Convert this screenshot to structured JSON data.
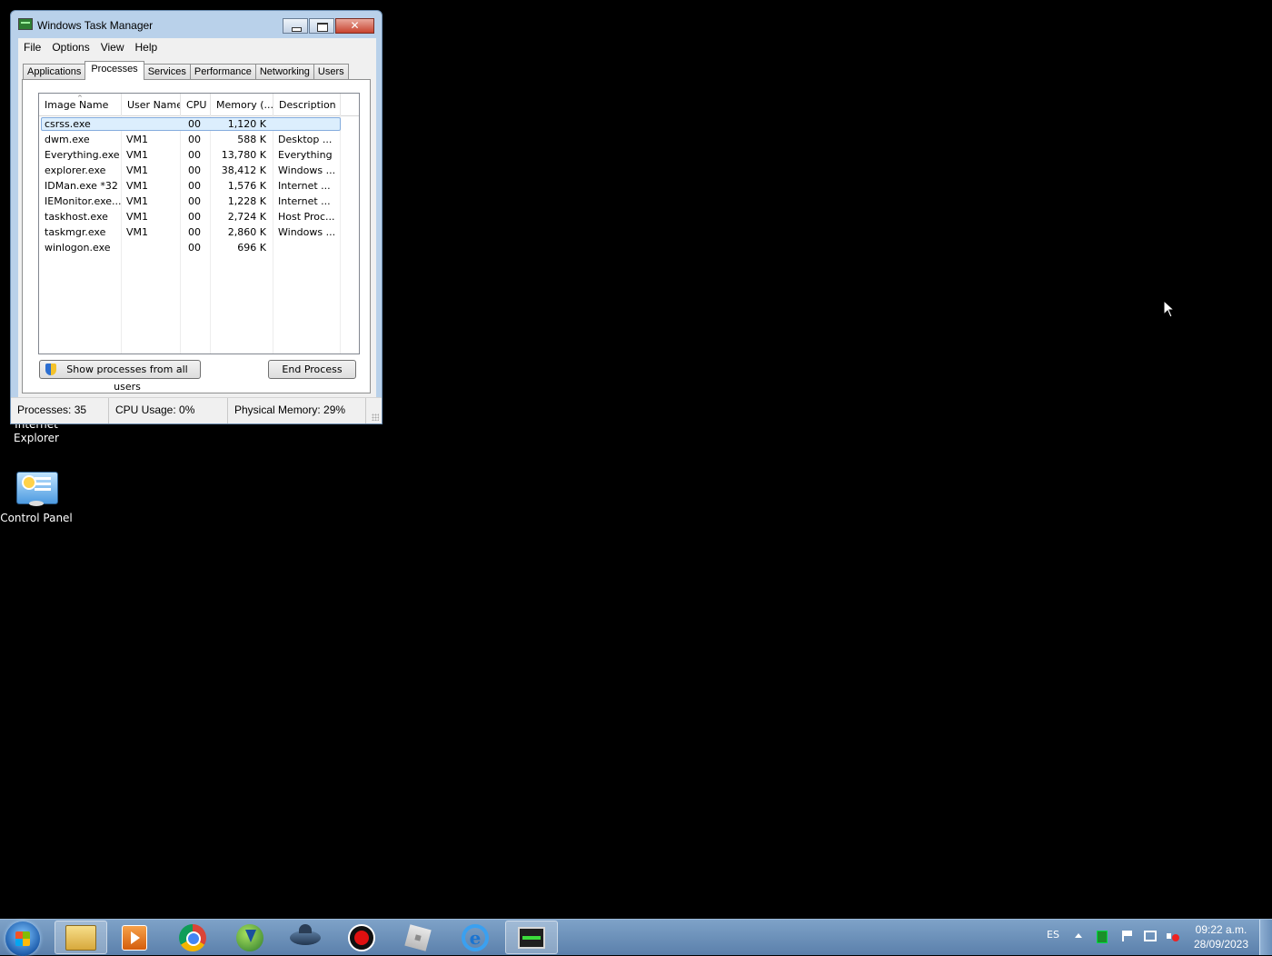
{
  "desktop": {
    "icons": [
      {
        "label_line1": "Internet",
        "label_line2": "Explorer"
      },
      {
        "label": "Control Panel"
      }
    ]
  },
  "window": {
    "title": "Windows Task Manager",
    "close_glyph": "✕",
    "menu": [
      "File",
      "Options",
      "View",
      "Help"
    ],
    "tabs": [
      "Applications",
      "Processes",
      "Services",
      "Performance",
      "Networking",
      "Users"
    ],
    "active_tab": "Processes",
    "columns": [
      "Image Name",
      "User Name",
      "CPU",
      "Memory (...",
      "Description"
    ],
    "sort_indicator": "^",
    "processes": [
      {
        "name": "csrss.exe",
        "user": "",
        "cpu": "00",
        "memory": "1,120 K",
        "description": ""
      },
      {
        "name": "dwm.exe",
        "user": "VM1",
        "cpu": "00",
        "memory": "588 K",
        "description": "Desktop ..."
      },
      {
        "name": "Everything.exe",
        "user": "VM1",
        "cpu": "00",
        "memory": "13,780 K",
        "description": "Everything"
      },
      {
        "name": "explorer.exe",
        "user": "VM1",
        "cpu": "00",
        "memory": "38,412 K",
        "description": "Windows ..."
      },
      {
        "name": "IDMan.exe *32",
        "user": "VM1",
        "cpu": "00",
        "memory": "1,576 K",
        "description": "Internet ..."
      },
      {
        "name": "IEMonitor.exe...",
        "user": "VM1",
        "cpu": "00",
        "memory": "1,228 K",
        "description": "Internet ..."
      },
      {
        "name": "taskhost.exe",
        "user": "VM1",
        "cpu": "00",
        "memory": "2,724 K",
        "description": "Host Proc..."
      },
      {
        "name": "taskmgr.exe",
        "user": "VM1",
        "cpu": "00",
        "memory": "2,860 K",
        "description": "Windows ..."
      },
      {
        "name": "winlogon.exe",
        "user": "",
        "cpu": "00",
        "memory": "696 K",
        "description": ""
      }
    ],
    "selected_row": 0,
    "show_all_button": "Show processes from all users",
    "end_process_button": "End Process",
    "status": {
      "processes": "Processes: 35",
      "cpu": "CPU Usage: 0%",
      "memory": "Physical Memory: 29%"
    }
  },
  "taskbar": {
    "apps": [
      "windows-explorer-icon",
      "media-player-icon",
      "chrome-icon",
      "internet-download-manager-icon",
      "ufo-app-icon",
      "screen-recorder-icon",
      "roblox-icon",
      "internet-explorer-icon",
      "task-manager-icon"
    ],
    "language": "ES",
    "time": "09:22 a.m.",
    "date": "28/09/2023"
  },
  "colors": {
    "desktop_bg": "#000000",
    "window_frame": "#b9d1ea",
    "selection": "#dceefd",
    "taskbar": "#5b80ab"
  }
}
